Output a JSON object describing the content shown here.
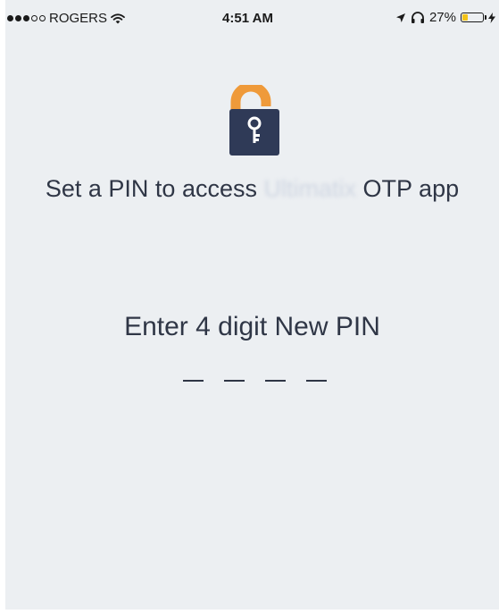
{
  "status_bar": {
    "carrier": "ROGERS",
    "time": "4:51 AM",
    "battery_text": "27%",
    "battery_level": 0.27,
    "signal_bars_filled": 3,
    "signal_bars_total": 5
  },
  "main": {
    "title_prefix": "Set a PIN to access",
    "title_app": "Ultimatix",
    "title_suffix": "OTP app",
    "pin_prompt": "Enter 4 digit New PIN",
    "pin_length": 4
  },
  "colors": {
    "background": "#eceff2",
    "text": "#2f3646",
    "lock_shackle": "#ef9a3a",
    "lock_body": "#2f3a57",
    "battery": "#f3c318"
  }
}
